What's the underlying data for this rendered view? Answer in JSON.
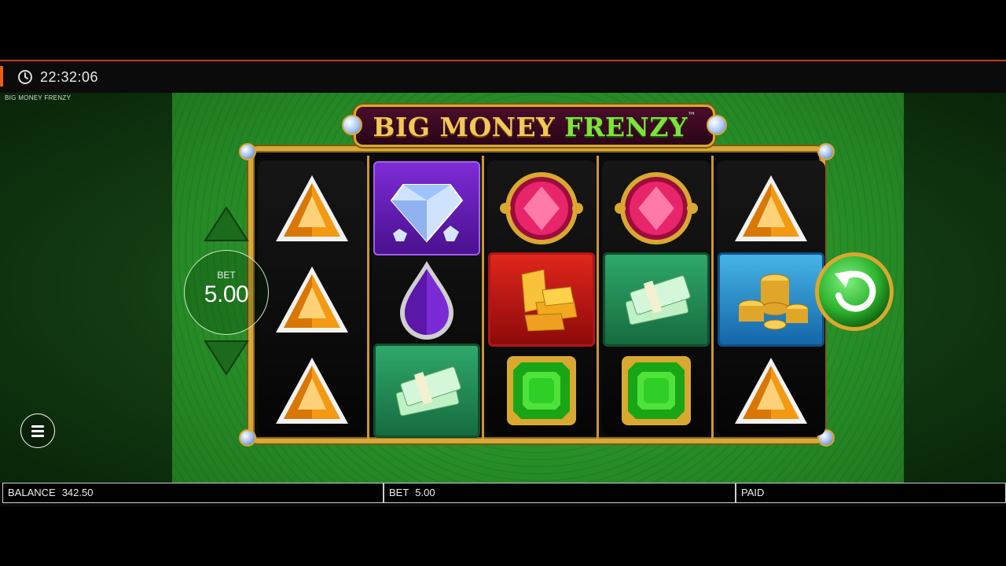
{
  "status_bar": {
    "time": "22:32:06",
    "clock_icon": "clock-icon"
  },
  "game": {
    "title_small": "BIG MONEY FRENZY",
    "logo": {
      "part1": "BIG MONEY",
      "part2": "FRENZY",
      "trademark": "™"
    }
  },
  "reels": [
    [
      "orange-triangle-gem",
      "orange-triangle-gem",
      "orange-triangle-gem"
    ],
    [
      "diamond-tile",
      "purple-drop-gem",
      "cash-stack-tile"
    ],
    [
      "red-round-gem",
      "gold-bars-tile",
      "green-square-gem"
    ],
    [
      "red-round-gem",
      "cash-stack-tile",
      "green-square-gem"
    ],
    [
      "orange-triangle-gem",
      "gold-coins-tile",
      "orange-triangle-gem"
    ]
  ],
  "bet_control": {
    "label": "BET",
    "value": "5.00"
  },
  "buttons": {
    "spin": "spin-icon",
    "menu": "menu-icon",
    "bet_up": "chevron-up-icon",
    "bet_down": "chevron-down-icon"
  },
  "bottom_bar": {
    "balance_label": "BALANCE",
    "balance_value": "342.50",
    "bet_label": "BET",
    "bet_value": "5.00",
    "paid_label": "PAID",
    "paid_value": ""
  },
  "colors": {
    "accent_orange": "#e8600f",
    "top_border": "#c0392b",
    "frame_gold": "#d8a83a",
    "spin_green": "#2fb52f"
  }
}
